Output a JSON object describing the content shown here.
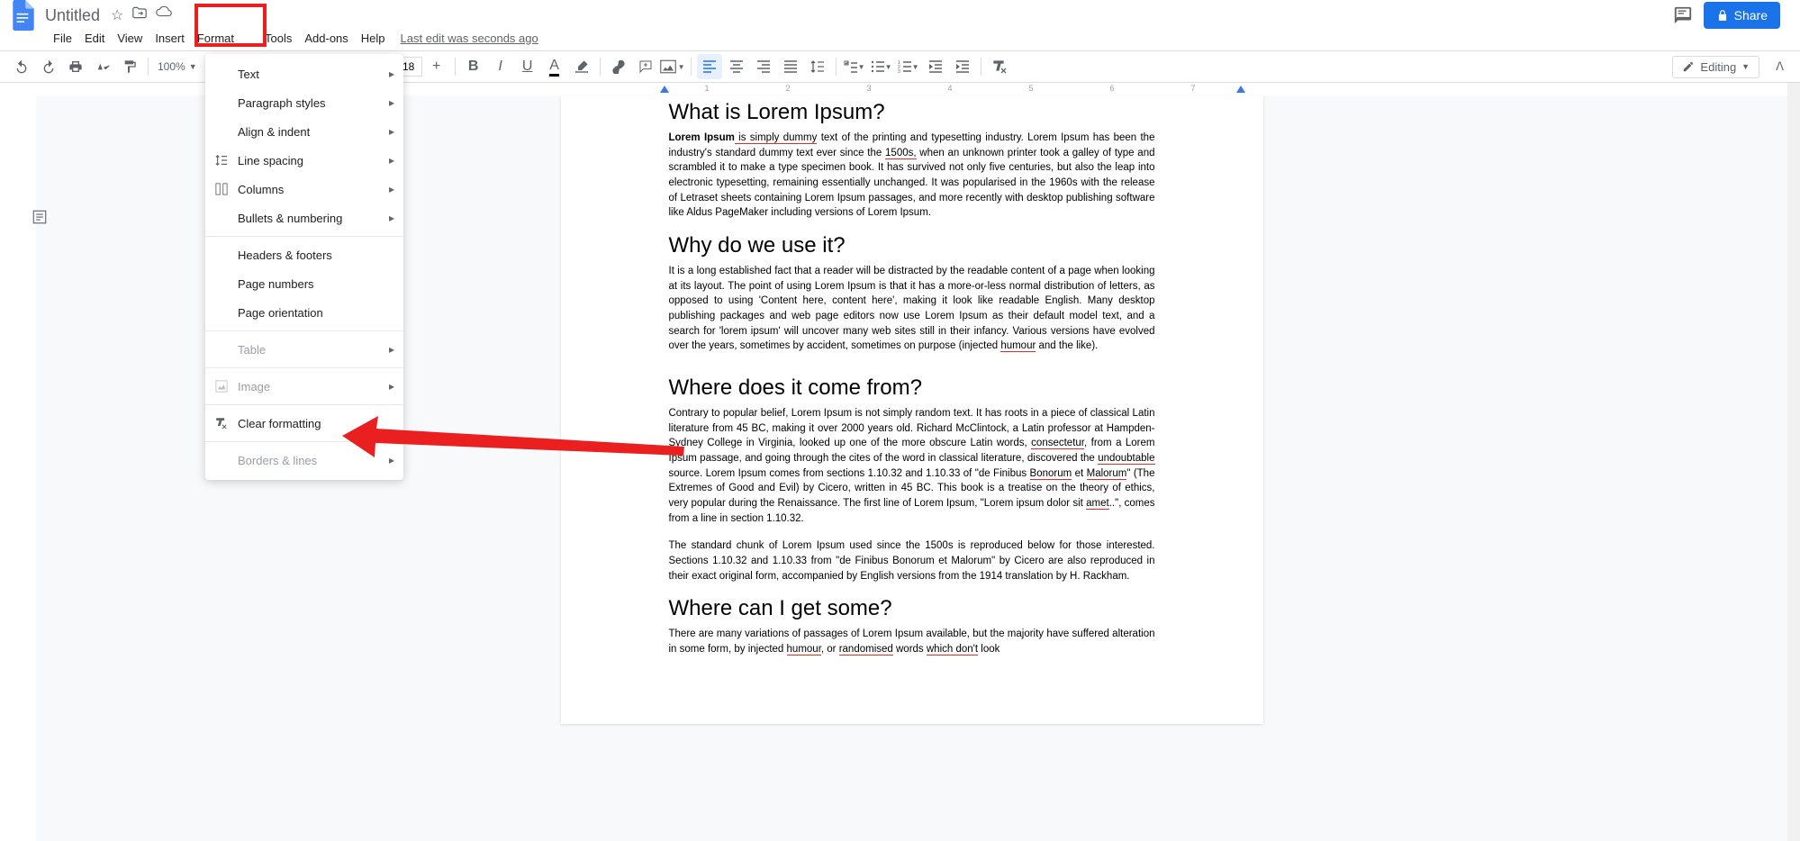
{
  "doc": {
    "title": "Untitled"
  },
  "menubar": {
    "file": "File",
    "edit": "Edit",
    "view": "View",
    "insert": "Insert",
    "format": "Format",
    "tools": "Tools",
    "addons": "Add-ons",
    "help": "Help",
    "last_edit": "Last edit was seconds ago"
  },
  "toolbar": {
    "zoom": "100%",
    "font_size": "18",
    "editing_mode": "Editing"
  },
  "format_menu": {
    "text": "Text",
    "paragraph_styles": "Paragraph styles",
    "align_indent": "Align & indent",
    "line_spacing": "Line spacing",
    "columns": "Columns",
    "bullets_numbering": "Bullets & numbering",
    "headers_footers": "Headers & footers",
    "page_numbers": "Page numbers",
    "page_orientation": "Page orientation",
    "table": "Table",
    "image": "Image",
    "clear_formatting": "Clear formatting",
    "borders_lines": "Borders & lines"
  },
  "share_button": "Share",
  "ruler_labels": [
    "1",
    "2",
    "3",
    "4",
    "5",
    "6",
    "7"
  ],
  "document": {
    "h1": "What is Lorem Ipsum?",
    "p1a": "Lorem Ipsum",
    "p1b": " is simply dummy",
    "p1c": " text of the printing and typesetting industry. Lorem Ipsum has been the industry's standard dummy text ever since the ",
    "p1d": "1500s,",
    "p1e": " when an unknown printer took a galley of type and scrambled it to make a type specimen book. It has survived not only five centuries, but also the leap into electronic typesetting, remaining essentially unchanged. It was popularised in the 1960s with the release of Letraset sheets containing Lorem Ipsum passages, and more recently with desktop publishing software like Aldus PageMaker including versions of Lorem Ipsum.",
    "h2": "Why do we use it?",
    "p2a": "It is a long established fact that a reader will be distracted by the readable content of a page when looking at its layout. The point of using Lorem Ipsum is that it has a more-or-less normal distribution of letters, as opposed to using 'Content here, content here', making it look like readable English. Many desktop publishing packages and web page editors now use Lorem Ipsum as their default model text, and a search for 'lorem ipsum' will uncover many web sites still in their infancy. Various versions have evolved over the years, sometimes by accident, sometimes on purpose (injected ",
    "p2b": "humour",
    "p2c": " and the like).",
    "h3": "Where does it come from?",
    "p3a": "Contrary to popular belief, Lorem Ipsum is not simply random text. It has roots in a piece of classical Latin literature from 45 BC, making it over 2000 years old. Richard McClintock, a Latin professor at Hampden-Sydney College in Virginia, looked up one of the more obscure Latin words, ",
    "p3b": "consectetur",
    "p3c": ", from a Lorem Ipsum passage, and going through the cites of the word in classical literature, discovered the ",
    "p3d": "undoubtable",
    "p3e": " source. Lorem Ipsum comes from sections 1.10.32 and 1.10.33 of \"de Finibus ",
    "p3f": "Bonorum",
    "p3g": " et ",
    "p3h": "Malorum",
    "p3i": "\" (The Extremes of Good and Evil) by Cicero, written in 45 BC. This book is a treatise on the theory of ethics, very popular during the Renaissance. The first line of Lorem Ipsum, \"Lorem ipsum dolor sit ",
    "p3j": "amet",
    "p3k": "..\", comes from a line in section 1.10.32.",
    "p4": "The standard chunk of Lorem Ipsum used since the 1500s is reproduced below for those interested. Sections 1.10.32 and 1.10.33 from \"de Finibus Bonorum et Malorum\" by Cicero are also reproduced in their exact original form, accompanied by English versions from the 1914 translation by H. Rackham.",
    "h4": "Where can I get some?",
    "p5a": "There are many variations of passages of Lorem Ipsum available, but the majority have suffered alteration in some form, by injected ",
    "p5b": "humour",
    "p5c": ", or ",
    "p5d": "randomised",
    "p5e": " words ",
    "p5f": "which don't",
    "p5g": " look"
  }
}
